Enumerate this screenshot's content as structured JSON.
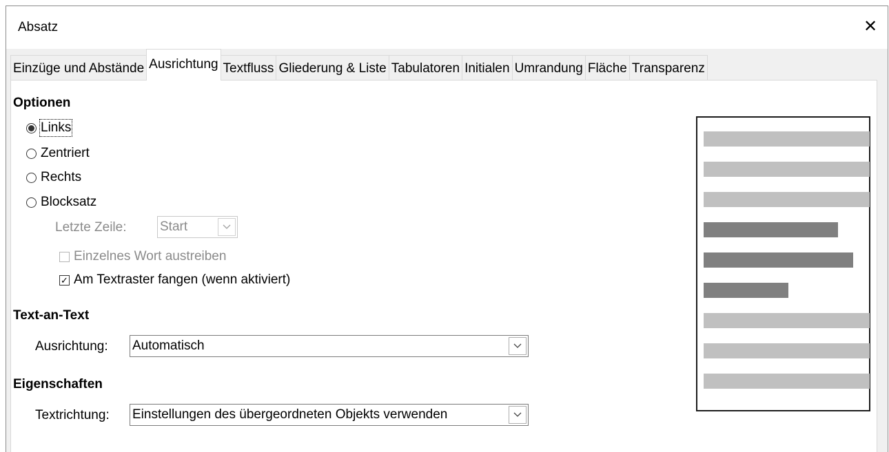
{
  "window": {
    "title": "Absatz",
    "close_glyph": "✕"
  },
  "tabs": [
    {
      "label": "Einzüge und Abstände",
      "active": false
    },
    {
      "label": "Ausrichtung",
      "active": true
    },
    {
      "label": "Textfluss",
      "active": false
    },
    {
      "label": "Gliederung & Liste",
      "active": false
    },
    {
      "label": "Tabulatoren",
      "active": false
    },
    {
      "label": "Initialen",
      "active": false
    },
    {
      "label": "Umrandung",
      "active": false
    },
    {
      "label": "Fläche",
      "active": false
    },
    {
      "label": "Transparenz",
      "active": false
    }
  ],
  "options": {
    "title": "Optionen",
    "radios": [
      {
        "label": "Links",
        "selected": true
      },
      {
        "label": "Zentriert",
        "selected": false
      },
      {
        "label": "Rechts",
        "selected": false
      },
      {
        "label": "Blocksatz",
        "selected": false
      }
    ],
    "last_line_label": "Letzte Zeile:",
    "last_line_value": "Start",
    "single_word_label": "Einzelnes Wort austreiben",
    "snap_label": "Am Textraster fangen (wenn aktiviert)",
    "check_glyph": "✓"
  },
  "text_to_text": {
    "title": "Text-an-Text",
    "label": "Ausrichtung:",
    "value": "Automatisch"
  },
  "properties": {
    "title": "Eigenschaften",
    "label": "Textrichtung:",
    "value": "Einstellungen des übergeordneten Objekts verwenden"
  },
  "icons": {
    "dropdown": "chevron-down-icon",
    "close": "close-icon"
  },
  "colors": {
    "preview_light": "#c0c0c0",
    "preview_dark": "#808080"
  },
  "preview_lines": [
    {
      "width_fraction": 1.0,
      "dark": false
    },
    {
      "width_fraction": 1.0,
      "dark": false
    },
    {
      "width_fraction": 1.0,
      "dark": false
    },
    {
      "width_fraction": 0.81,
      "dark": true
    },
    {
      "width_fraction": 0.9,
      "dark": true
    },
    {
      "width_fraction": 0.51,
      "dark": true
    },
    {
      "width_fraction": 1.0,
      "dark": false
    },
    {
      "width_fraction": 1.0,
      "dark": false
    },
    {
      "width_fraction": 1.0,
      "dark": false
    }
  ]
}
